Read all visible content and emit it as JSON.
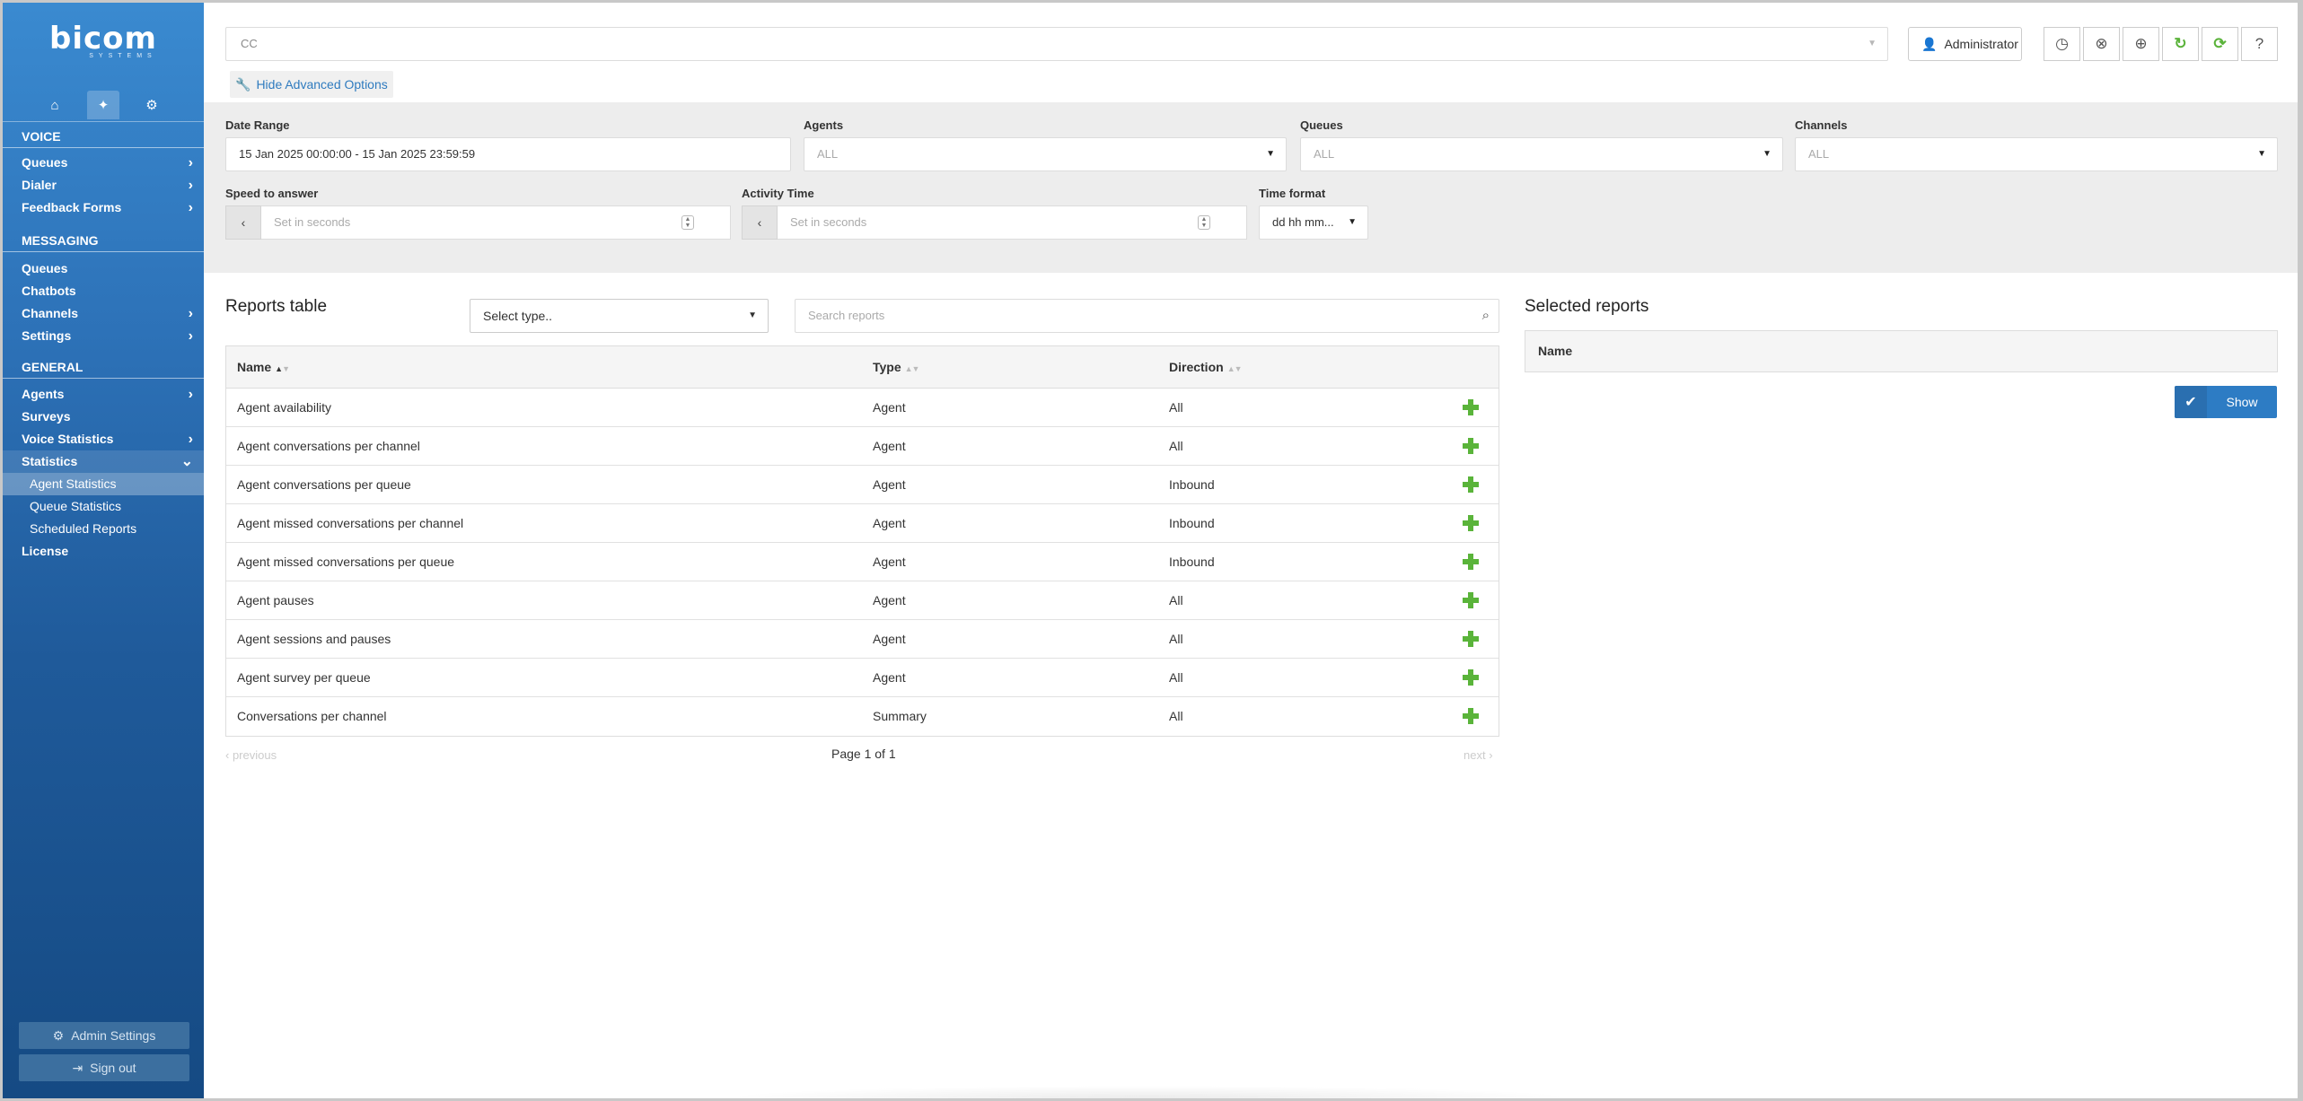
{
  "brand": {
    "logo": "bicom",
    "logo_sub": "SYSTEMS"
  },
  "sidebar": {
    "top_icons": [
      "home-icon",
      "satellite-icon",
      "cogs-icon"
    ],
    "sections": {
      "voice": "VOICE",
      "messaging": "MESSAGING",
      "general": "GENERAL"
    },
    "voice_items": [
      {
        "label": "Queues",
        "chevron": "›"
      },
      {
        "label": "Dialer",
        "chevron": "›"
      },
      {
        "label": "Feedback Forms",
        "chevron": "›"
      }
    ],
    "messaging_items": [
      {
        "label": "Queues",
        "chevron": ""
      },
      {
        "label": "Chatbots",
        "chevron": ""
      },
      {
        "label": "Channels",
        "chevron": "›"
      },
      {
        "label": "Settings",
        "chevron": "›"
      }
    ],
    "general_items": [
      {
        "label": "Agents",
        "chevron": "›"
      },
      {
        "label": "Surveys",
        "chevron": ""
      },
      {
        "label": "Voice Statistics",
        "chevron": "›"
      },
      {
        "label": "Statistics",
        "chevron": "⌄"
      }
    ],
    "statistics_sub": [
      "Agent Statistics",
      "Queue Statistics",
      "Scheduled Reports"
    ],
    "license": "License",
    "admin_settings": "Admin Settings",
    "sign_out": "Sign out"
  },
  "topbar": {
    "tenant_select": "CC",
    "user": "Administrator",
    "tool_icons": [
      "clock-icon",
      "lifebuoy-icon",
      "globe-icon",
      "refresh-icon",
      "sync-icon",
      "help-icon"
    ]
  },
  "advanced_toggle": "Hide Advanced Options",
  "filters": {
    "date_range_label": "Date Range",
    "date_range_value": "15 Jan 2025 00:00:00 - 15 Jan 2025 23:59:59",
    "agents_label": "Agents",
    "agents_value": "ALL",
    "queues_label": "Queues",
    "queues_value": "ALL",
    "channels_label": "Channels",
    "channels_value": "ALL",
    "speed_label": "Speed to answer",
    "speed_placeholder": "Set in seconds",
    "activity_label": "Activity Time",
    "activity_placeholder": "Set in seconds",
    "time_format_label": "Time format",
    "time_format_value": "dd hh mm..."
  },
  "reports": {
    "title": "Reports table",
    "type_select": "Select type..",
    "search_placeholder": "Search reports",
    "columns": [
      "Name",
      "Type",
      "Direction"
    ],
    "rows": [
      {
        "name": "Agent availability",
        "type": "Agent",
        "direction": "All"
      },
      {
        "name": "Agent conversations per channel",
        "type": "Agent",
        "direction": "All"
      },
      {
        "name": "Agent conversations per queue",
        "type": "Agent",
        "direction": "Inbound"
      },
      {
        "name": "Agent missed conversations per channel",
        "type": "Agent",
        "direction": "Inbound"
      },
      {
        "name": "Agent missed conversations per queue",
        "type": "Agent",
        "direction": "Inbound"
      },
      {
        "name": "Agent pauses",
        "type": "Agent",
        "direction": "All"
      },
      {
        "name": "Agent sessions and pauses",
        "type": "Agent",
        "direction": "All"
      },
      {
        "name": "Agent survey per queue",
        "type": "Agent",
        "direction": "All"
      },
      {
        "name": "Conversations per channel",
        "type": "Summary",
        "direction": "All"
      }
    ],
    "pager": {
      "prev": "previous",
      "page": "Page 1 of 1",
      "next": "next"
    }
  },
  "selected": {
    "title": "Selected reports",
    "column": "Name",
    "show_button": "Show"
  },
  "colors": {
    "accent": "#2d7cc4",
    "add": "#5ab43a",
    "sidebar_top": "#3a8ad0",
    "sidebar_bottom": "#154a83"
  }
}
